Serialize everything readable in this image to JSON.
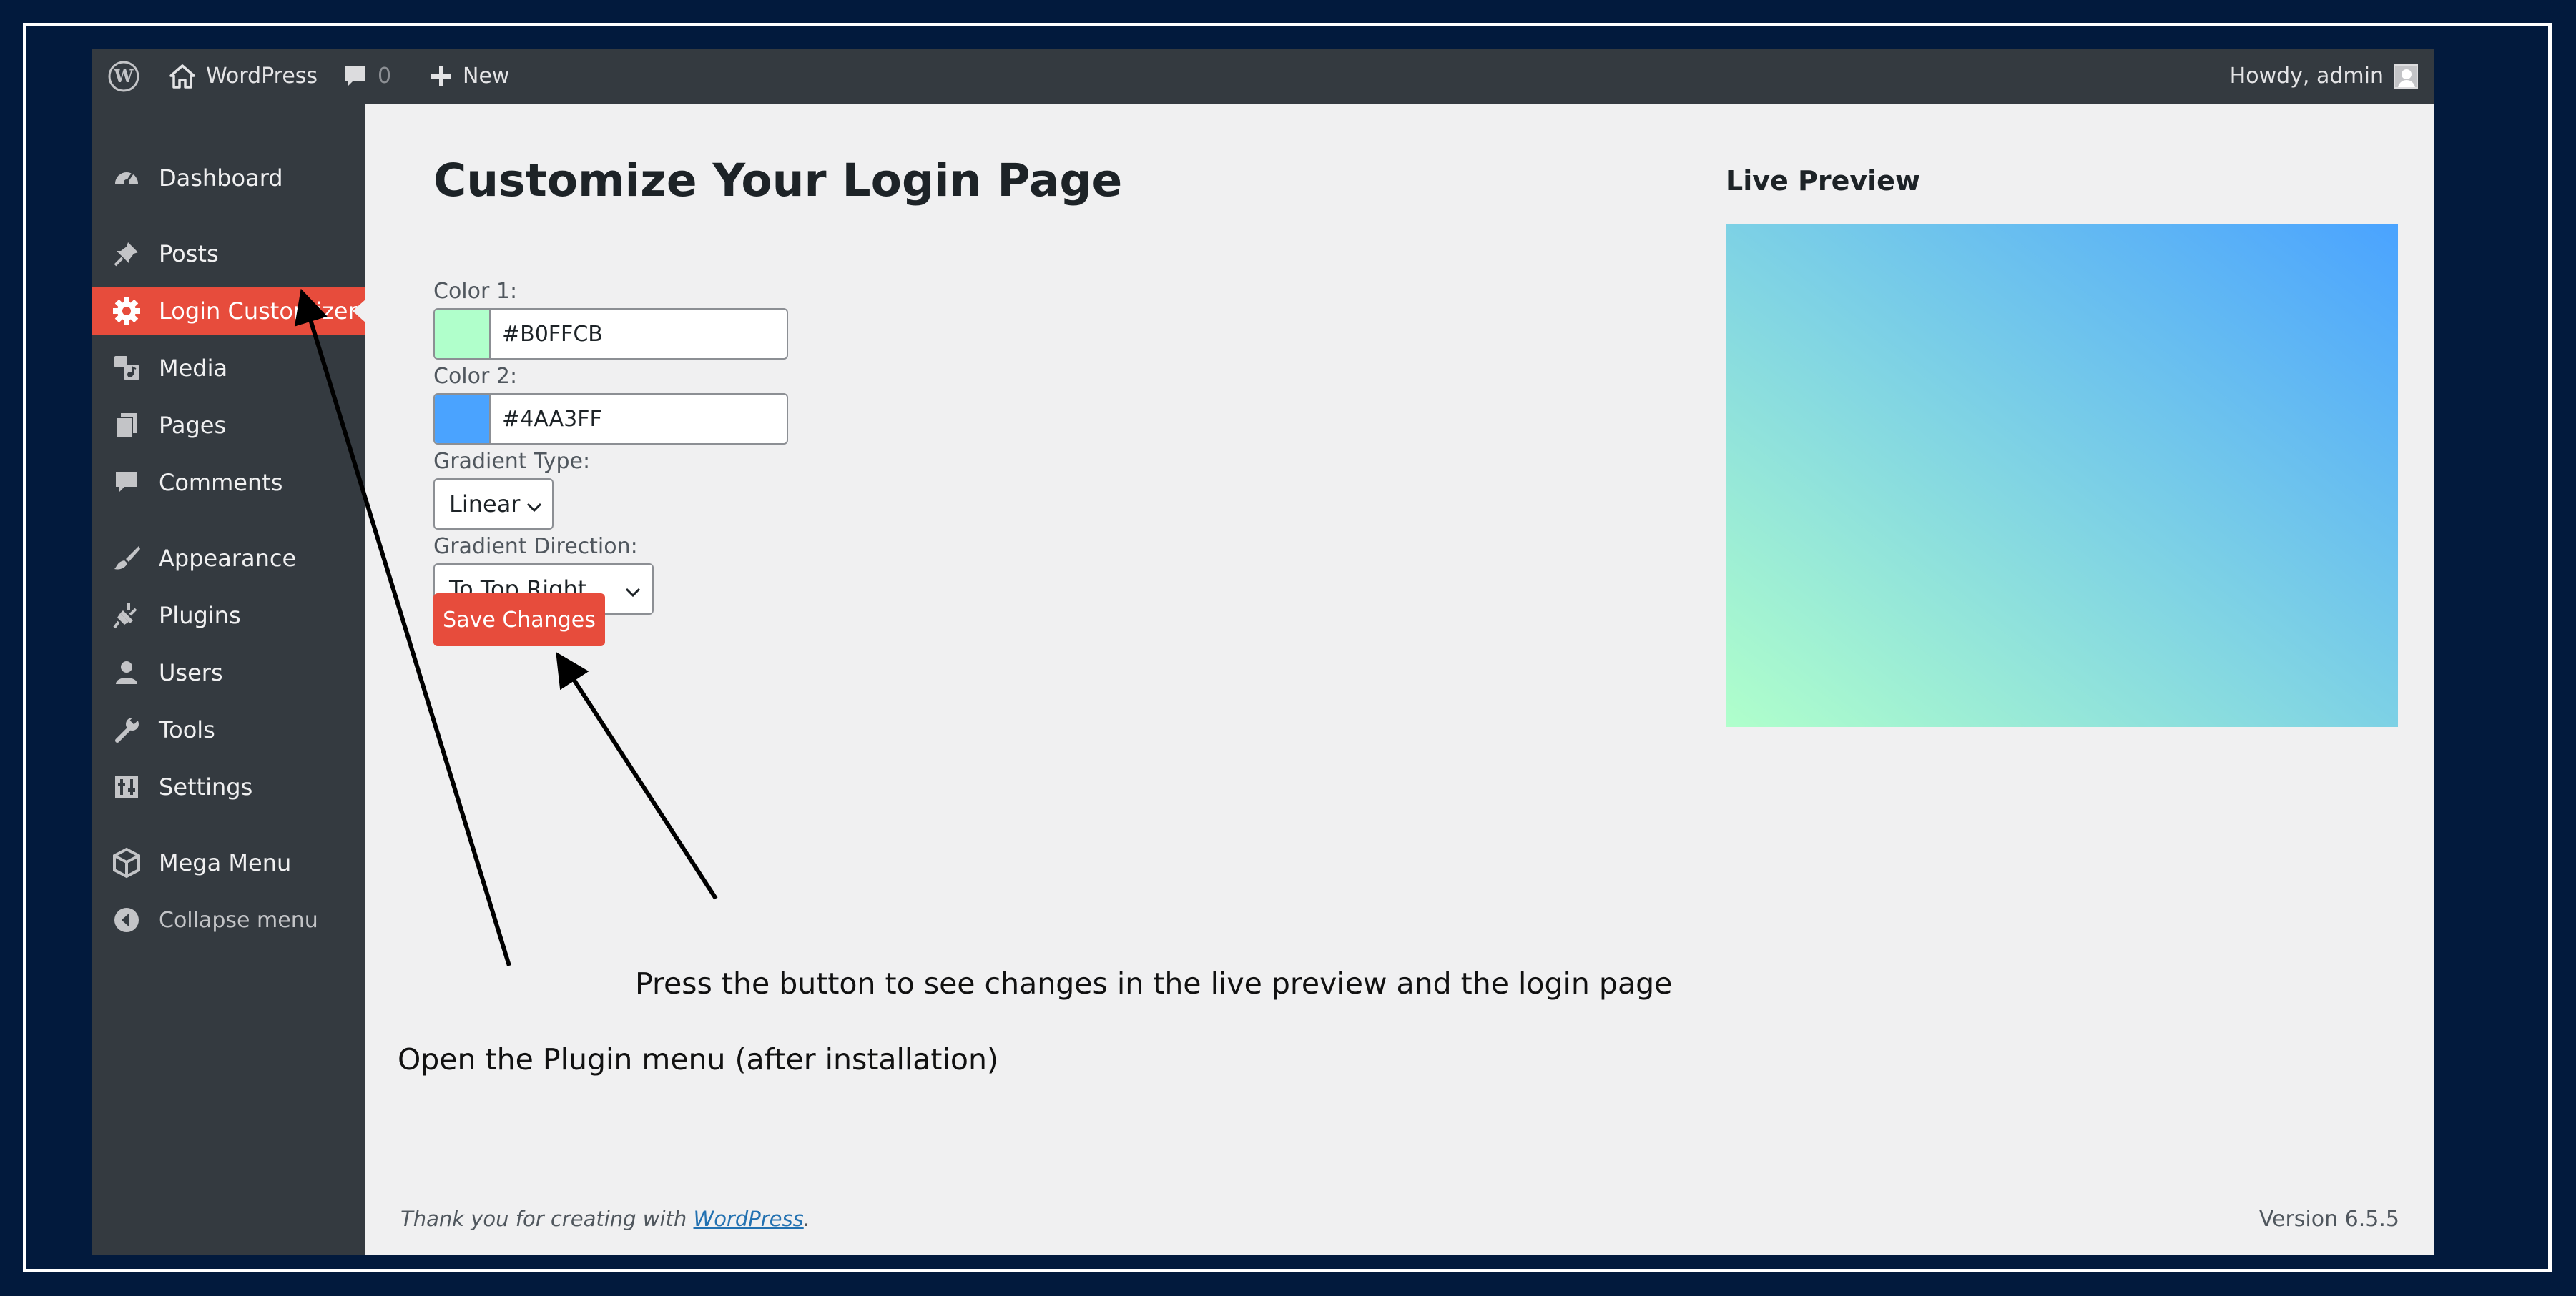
{
  "adminbar": {
    "site_name": "WordPress",
    "comments_count": "0",
    "new_label": "New",
    "howdy": "Howdy, admin"
  },
  "sidebar": {
    "items": [
      {
        "label": "Dashboard",
        "icon": "dashboard-icon"
      },
      {
        "label": "Posts",
        "icon": "pin-icon"
      },
      {
        "label": "Login Customizer",
        "icon": "gear-icon",
        "active": true
      },
      {
        "label": "Media",
        "icon": "media-icon"
      },
      {
        "label": "Pages",
        "icon": "pages-icon"
      },
      {
        "label": "Comments",
        "icon": "comment-icon"
      },
      {
        "label": "Appearance",
        "icon": "paintbrush-icon"
      },
      {
        "label": "Plugins",
        "icon": "plugin-icon"
      },
      {
        "label": "Users",
        "icon": "user-icon"
      },
      {
        "label": "Tools",
        "icon": "wrench-icon"
      },
      {
        "label": "Settings",
        "icon": "settings-icon"
      },
      {
        "label": "Mega Menu",
        "icon": "mega-menu-icon"
      }
    ],
    "collapse_label": "Collapse menu"
  },
  "main": {
    "title": "Customize Your Login Page",
    "color1": {
      "label": "Color 1:",
      "value": "#B0FFCB",
      "swatch": "#b0ffcb"
    },
    "color2": {
      "label": "Color 2:",
      "value": "#4AA3FF",
      "swatch": "#4aa3ff"
    },
    "gradient_type": {
      "label": "Gradient Type:",
      "value": "Linear"
    },
    "gradient_direction": {
      "label": "Gradient Direction:",
      "value": "To Top Right"
    },
    "save_label": "Save Changes"
  },
  "preview": {
    "title": "Live Preview",
    "gradient_direction": "to top right"
  },
  "annotations": {
    "press_button": "Press the button to see changes in the live preview and the login page",
    "open_plugin": "Open the Plugin menu (after installation)"
  },
  "footer": {
    "thanks": "Thank you for creating with",
    "link": "WordPress",
    "version": "Version 6.5.5"
  },
  "colors": {
    "accent": "#e74c3c",
    "adminbar": "#343a40",
    "frame": "#021a3d"
  }
}
